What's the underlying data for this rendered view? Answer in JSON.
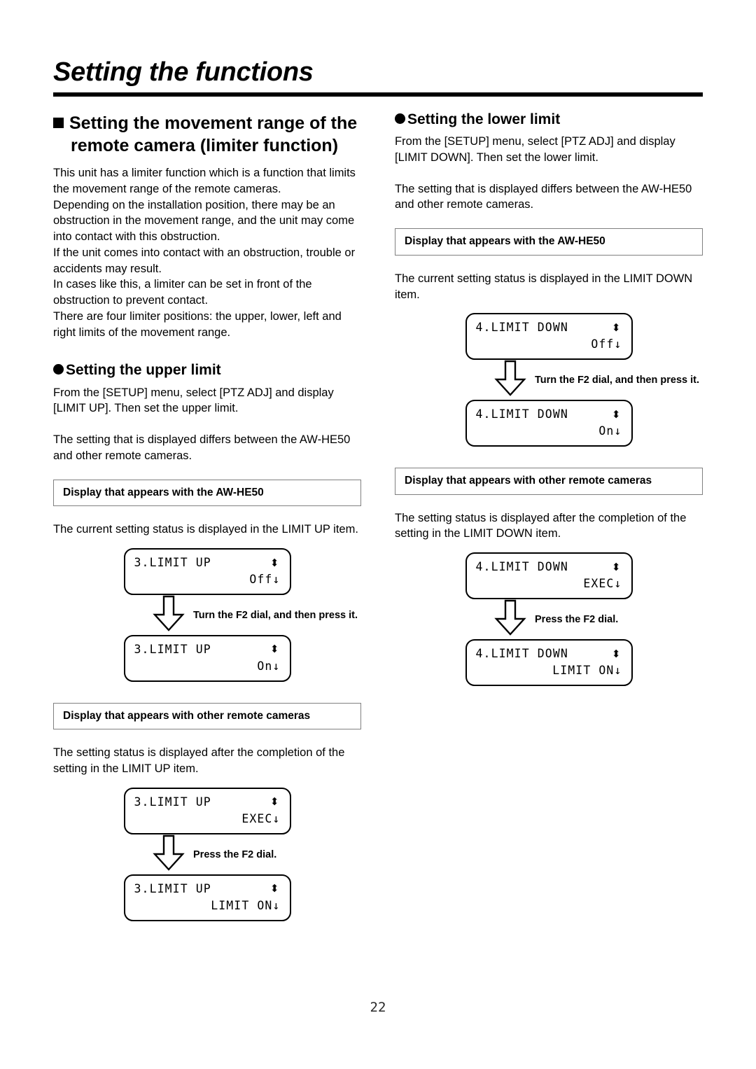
{
  "document": {
    "title": "Setting the functions",
    "page_number": "22"
  },
  "left_column": {
    "section_heading": "Setting the movement range of the remote camera (limiter function)",
    "intro_paragraphs": [
      "This unit has a limiter function which is a function that limits the movement range of the remote cameras.",
      "Depending on the installation position, there may be an obstruction in the movement range, and the unit may come into contact with this obstruction.",
      "If the unit comes into contact with an obstruction, trouble or accidents may result.",
      "In cases like this, a limiter can be set in front of the obstruction to prevent contact.",
      "There are four limiter positions: the upper, lower, left and right limits of the movement range."
    ],
    "subsection_heading": "Setting the upper limit",
    "instruction_paragraph": "From the [SETUP] menu, select [PTZ ADJ] and display [LIMIT UP]. Then set the upper limit.",
    "differs_paragraph": "The setting that is displayed differs between the AW-HE50 and other remote cameras.",
    "he50_box_label": "Display that appears with the AW-HE50",
    "he50_description": "The current setting status is displayed in the LIMIT UP item.",
    "he50_lcd_before": {
      "line1": "3.LIMIT UP",
      "line2": "Off↓",
      "arrow_glyph": "⬍"
    },
    "he50_step_caption": "Turn the F2 dial, and then press it.",
    "he50_lcd_after": {
      "line1": "3.LIMIT UP",
      "line2": "On↓",
      "arrow_glyph": "⬍"
    },
    "other_box_label": "Display that appears with other remote cameras",
    "other_description": "The setting status is displayed after the completion of the setting in the LIMIT UP item.",
    "other_lcd_before": {
      "line1": "3.LIMIT UP",
      "line2": "EXEC↓",
      "arrow_glyph": "⬍"
    },
    "other_step_caption": "Press the F2 dial.",
    "other_lcd_after": {
      "line1": "3.LIMIT UP",
      "line2": "LIMIT ON↓",
      "arrow_glyph": "⬍"
    }
  },
  "right_column": {
    "subsection_heading": "Setting the lower limit",
    "instruction_paragraph": "From the [SETUP] menu, select [PTZ ADJ] and display [LIMIT DOWN]. Then set the lower limit.",
    "differs_paragraph": "The setting that is displayed differs between the AW-HE50 and other remote cameras.",
    "he50_box_label": "Display that appears with the AW-HE50",
    "he50_description": "The current setting status is displayed in the LIMIT DOWN item.",
    "he50_lcd_before": {
      "line1": "4.LIMIT DOWN",
      "line2": "Off↓",
      "arrow_glyph": "⬍"
    },
    "he50_step_caption": "Turn the F2 dial, and then press it.",
    "he50_lcd_after": {
      "line1": "4.LIMIT DOWN",
      "line2": "On↓",
      "arrow_glyph": "⬍"
    },
    "other_box_label": "Display that appears with other remote cameras",
    "other_description": "The setting status is displayed after the completion of the setting in the LIMIT DOWN item.",
    "other_lcd_before": {
      "line1": "4.LIMIT DOWN",
      "line2": "EXEC↓",
      "arrow_glyph": "⬍"
    },
    "other_step_caption": "Press the F2 dial.",
    "other_lcd_after": {
      "line1": "4.LIMIT DOWN",
      "line2": "LIMIT ON↓",
      "arrow_glyph": "⬍"
    }
  },
  "colors": {
    "text": "#000000",
    "box_border": "#808080",
    "rule": "#000000"
  }
}
